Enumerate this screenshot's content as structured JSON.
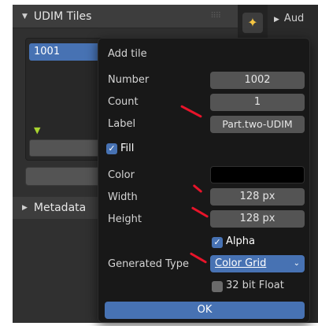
{
  "left_panel": {
    "udim_header": "UDIM Tiles",
    "tiles": [
      {
        "name": "1001"
      }
    ],
    "metadata_header": "Metadata"
  },
  "right_panel": {
    "first_row": "Aud"
  },
  "popup": {
    "title": "Add tile",
    "number_label": "Number",
    "number_value": "1002",
    "count_label": "Count",
    "count_value": "1",
    "label_label": "Label",
    "label_value": "Part.two-UDIM",
    "fill_label": "Fill",
    "fill_checked": true,
    "color_label": "Color",
    "color_value": "#000000",
    "width_label": "Width",
    "width_value": "128 px",
    "height_label": "Height",
    "height_value": "128 px",
    "alpha_label": "Alpha",
    "alpha_checked": true,
    "generated_type_label": "Generated Type",
    "generated_type_value": "Color Grid",
    "float_label": "32 bit Float",
    "float_checked": false,
    "ok_label": "OK"
  },
  "colors": {
    "accent": "#4772b3",
    "annotation": "#e8142a"
  }
}
